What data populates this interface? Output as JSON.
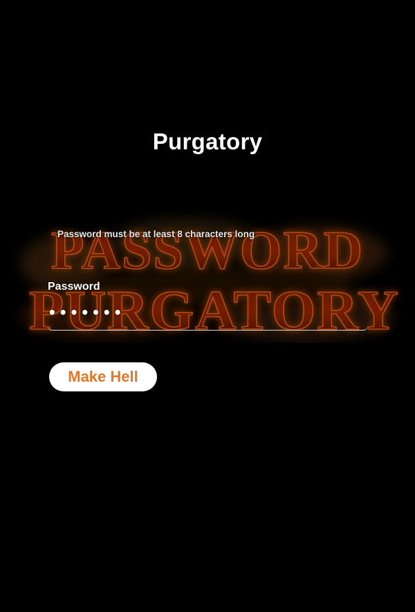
{
  "header": {
    "title": "Purgatory"
  },
  "logo": {
    "lines": [
      "PASSWORD",
      "PURGATORY"
    ],
    "icon": "fiery-logo-image",
    "colors": {
      "text": "#7a1e08",
      "stroke": "#c2531c",
      "flame": "#ff8a2a"
    }
  },
  "form": {
    "hint": "Password must be at least 8 characters long",
    "password_label": "Password",
    "password_value": "•••••••",
    "button_label": "Make Hell"
  },
  "colors": {
    "background": "#000000",
    "button_bg": "#ffffff",
    "button_text": "#e0782a"
  }
}
